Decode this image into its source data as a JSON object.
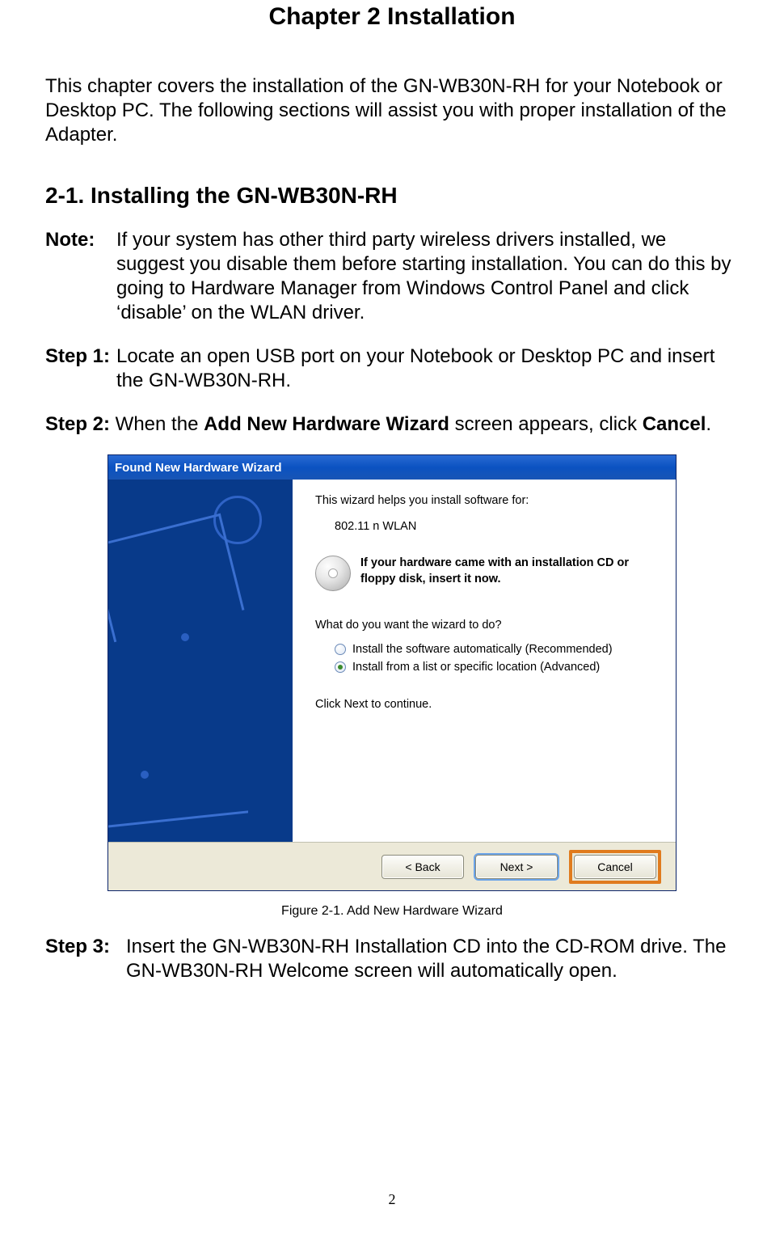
{
  "chapter_title": "Chapter 2    Installation",
  "intro": "This chapter covers the installation of the GN-WB30N-RH for your Notebook or Desktop PC. The following sections will assist you with proper installation of the Adapter.",
  "section_title": "2-1.  Installing the GN-WB30N-RH",
  "note": {
    "label": "Note:",
    "text": "If your system has other third party wireless drivers installed, we suggest you disable them before starting installation. You can do this by going to Hardware Manager from Windows Control Panel and click ‘disable’ on the WLAN driver."
  },
  "step1": {
    "label": "Step 1:",
    "text": "Locate an open USB port on your Notebook or Desktop PC and insert the GN-WB30N-RH."
  },
  "step2": {
    "label": "Step 2:",
    "pre": " When the ",
    "bold1": "Add New Hardware Wizard",
    "mid": " screen appears, click ",
    "bold2": "Cancel",
    "post": "."
  },
  "wizard": {
    "title": "Found New Hardware Wizard",
    "line1": "This wizard helps you install software for:",
    "device": "802.11 n WLAN",
    "cd_text": "If your hardware came with an installation CD or floppy disk, insert it now.",
    "question": "What do you want the wizard to do?",
    "opt1": "Install the software automatically (Recommended)",
    "opt2": "Install from a list or specific location (Advanced)",
    "click_next": "Click Next to continue.",
    "back": "< Back",
    "next": "Next >",
    "cancel": "Cancel"
  },
  "caption": "Figure 2-1. Add New Hardware Wizard",
  "step3": {
    "label": "Step 3:",
    "text": "Insert the GN-WB30N-RH Installation CD into the CD-ROM drive. The GN-WB30N-RH Welcome screen will automatically open."
  },
  "page_number": "2"
}
